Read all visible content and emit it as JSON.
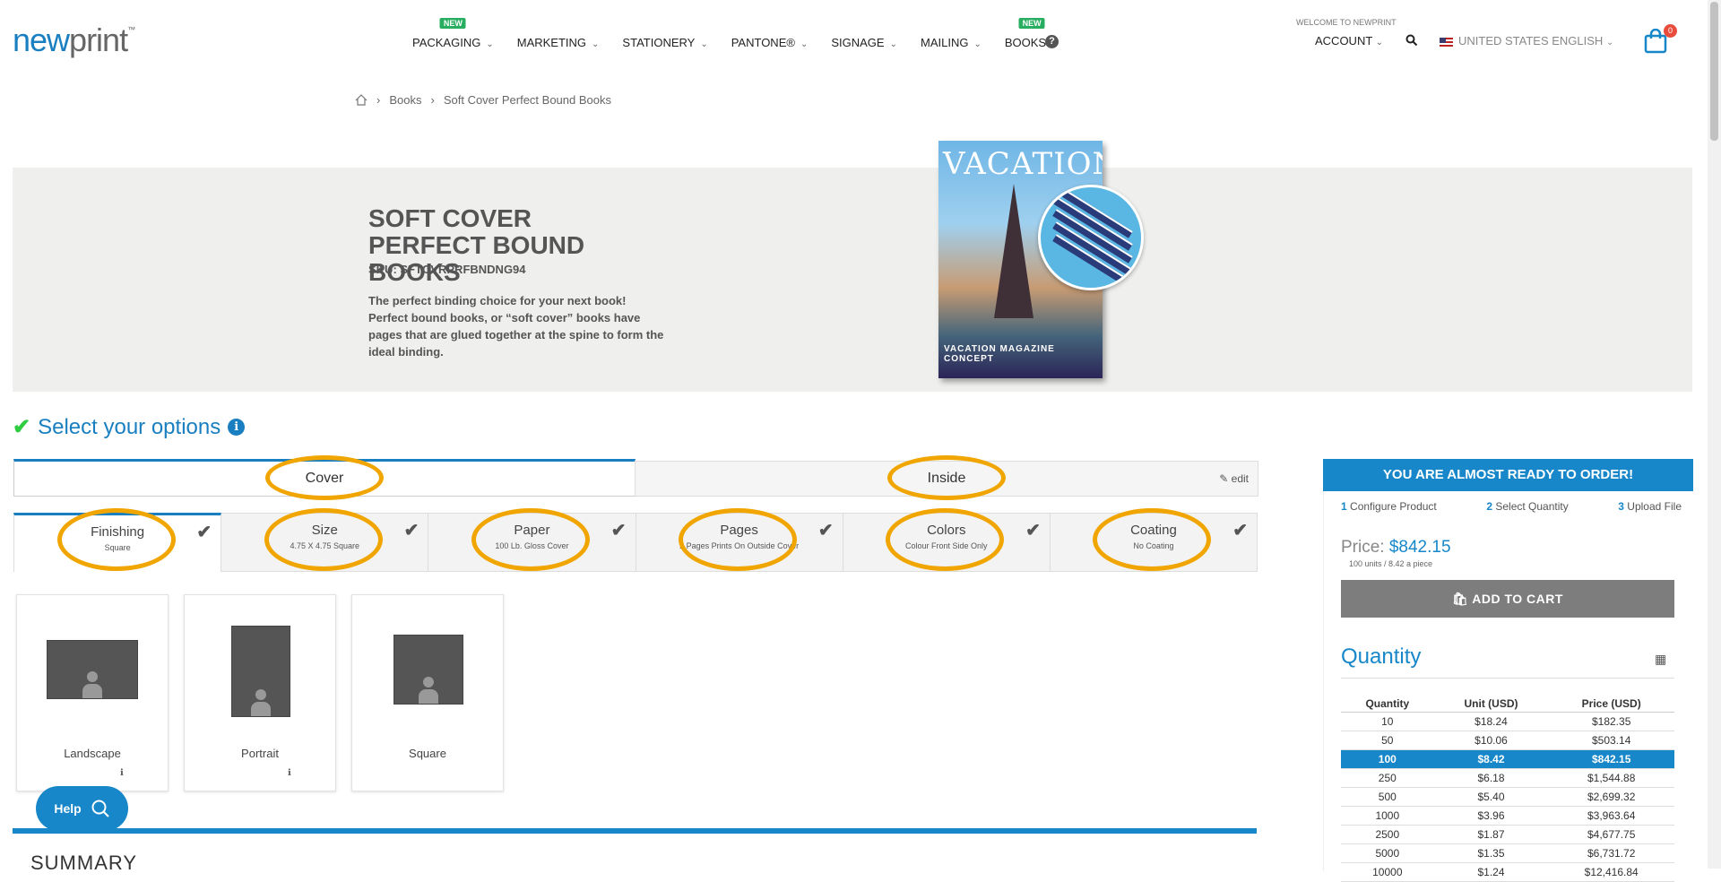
{
  "header": {
    "logo_new": "new",
    "logo_print": "print",
    "logo_tm": "™",
    "nav": [
      {
        "label": "PACKAGING",
        "badge": "NEW"
      },
      {
        "label": "MARKETING",
        "badge": ""
      },
      {
        "label": "STATIONERY",
        "badge": ""
      },
      {
        "label": "PANTONE®",
        "badge": ""
      },
      {
        "label": "SIGNAGE",
        "badge": ""
      },
      {
        "label": "MAILING",
        "badge": ""
      },
      {
        "label": "BOOKS",
        "badge": "NEW"
      }
    ],
    "welcome": "WELCOME TO NEWPRINT",
    "account": "ACCOUNT",
    "language": "UNITED STATES ENGLISH",
    "cart_count": "0"
  },
  "breadcrumb": {
    "items": [
      "Books",
      "Soft Cover Perfect Bound Books"
    ]
  },
  "hero": {
    "title": "SOFT COVER PERFECT BOUND BOOKS",
    "sku": "SKU: SFTCVRPRFBNDNG94",
    "description": "The perfect binding choice for your next book! Perfect bound books, or “soft cover” books have pages that are glued together at the spine to form the ideal binding.",
    "book_title": "VACATION",
    "book_footer": "VACATION MAGAZINE CONCEPT"
  },
  "options": {
    "heading": "Select your options",
    "tabs": {
      "cover": "Cover",
      "inside": "Inside",
      "edit": "edit"
    },
    "subtabs": [
      {
        "name": "Finishing",
        "value": "Square"
      },
      {
        "name": "Size",
        "value": "4.75 X 4.75 Square"
      },
      {
        "name": "Paper",
        "value": "100 Lb. Gloss Cover"
      },
      {
        "name": "Pages",
        "value": "2 Pages Prints On Outside Cover"
      },
      {
        "name": "Colors",
        "value": "Colour Front Side Only"
      },
      {
        "name": "Coating",
        "value": "No Coating"
      }
    ],
    "cards": [
      {
        "label": "Landscape"
      },
      {
        "label": "Portrait"
      },
      {
        "label": "Square"
      }
    ],
    "highlight_color": "#f0a500"
  },
  "help": {
    "label": "Help"
  },
  "summary": {
    "title": "SUMMARY"
  },
  "sidebar": {
    "ready": "YOU ARE ALMOST READY TO ORDER!",
    "steps": [
      {
        "num": "1",
        "label": "Configure Product"
      },
      {
        "num": "2",
        "label": "Select Quantity"
      },
      {
        "num": "3",
        "label": "Upload File"
      }
    ],
    "price_label": "Price:",
    "price_value": "$842.15",
    "price_sub": "100 units / 8.42 a piece",
    "add_to_cart": "ADD TO CART",
    "quantity_title": "Quantity",
    "table": {
      "headers": [
        "Quantity",
        "Unit (USD)",
        "Price (USD)"
      ],
      "rows": [
        [
          "10",
          "$18.24",
          "$182.35"
        ],
        [
          "50",
          "$10.06",
          "$503.14"
        ],
        [
          "100",
          "$8.42",
          "$842.15"
        ],
        [
          "250",
          "$6.18",
          "$1,544.88"
        ],
        [
          "500",
          "$5.40",
          "$2,699.32"
        ],
        [
          "1000",
          "$3.96",
          "$3,963.64"
        ],
        [
          "2500",
          "$1.87",
          "$4,677.75"
        ],
        [
          "5000",
          "$1.35",
          "$6,731.72"
        ],
        [
          "10000",
          "$1.24",
          "$12,416.84"
        ]
      ],
      "selected_quantity": "100"
    }
  },
  "colors": {
    "accent": "#1787c9",
    "brand": "#1a7fc1",
    "check": "#2ecc40"
  }
}
